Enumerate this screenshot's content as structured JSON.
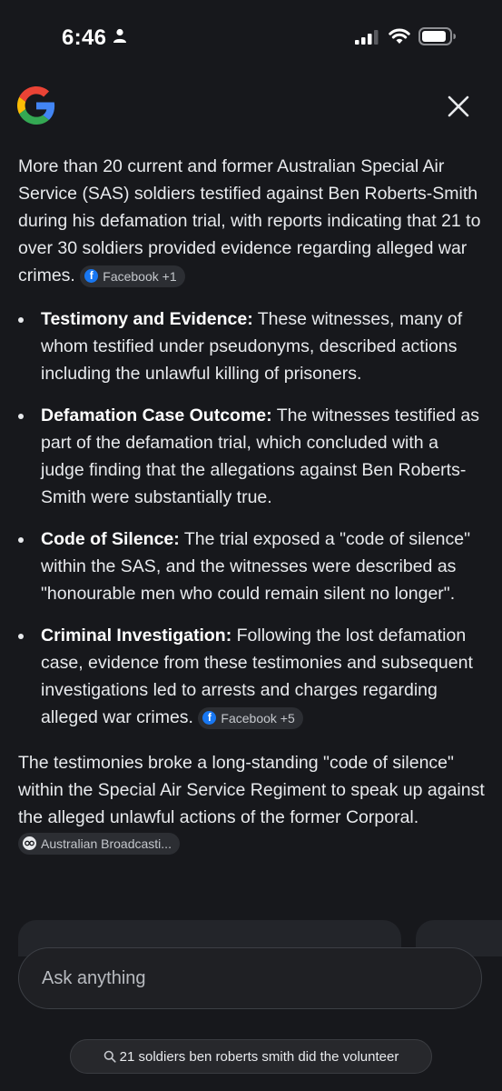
{
  "status_bar": {
    "time": "6:46",
    "icons": [
      "person-icon",
      "signal-icon",
      "wifi-icon",
      "battery-icon"
    ]
  },
  "header": {
    "logo": "google-logo",
    "close_icon": "close-icon"
  },
  "answer": {
    "intro": "More than 20 current and former Australian Special Air Service (SAS) soldiers testified against Ben Roberts-Smith during his defamation trial, with reports indicating that 21 to over 30 soldiers provided evidence regarding alleged war crimes.",
    "intro_source": "Facebook +1",
    "bullets": [
      {
        "title": "Testimony and Evidence:",
        "text": " These witnesses, many of whom testified under pseudonyms, described actions including the unlawful killing of prisoners."
      },
      {
        "title": "Defamation Case Outcome:",
        "text": " The witnesses testified as part of the defamation trial, which concluded with a judge finding that the allegations against Ben Roberts-Smith were substantially true."
      },
      {
        "title": "Code of Silence:",
        "text": " The trial exposed a \"code of silence\" within the SAS, and the witnesses were described as \"honourable men who could remain silent no longer\"."
      },
      {
        "title": "Criminal Investigation:",
        "text": " Following the lost defamation case, evidence from these testimonies and subsequent investigations led to arrests and charges regarding alleged war crimes.",
        "source": "Facebook +5"
      }
    ],
    "outro": "The testimonies broke a long-standing \"code of silence\" within the Special Air Service Regiment to speak up against the alleged unlawful actions of the former Corporal.",
    "outro_source": "Australian Broadcasti..."
  },
  "input": {
    "placeholder": "Ask anything"
  },
  "query_chip": {
    "text": "21 soldiers ben roberts smith did the volunteer",
    "icon": "search-icon"
  },
  "colors": {
    "background": "#17181c",
    "text": "#e8eaed",
    "chip_bg": "#2c2e33",
    "facebook_blue": "#1877f2"
  }
}
